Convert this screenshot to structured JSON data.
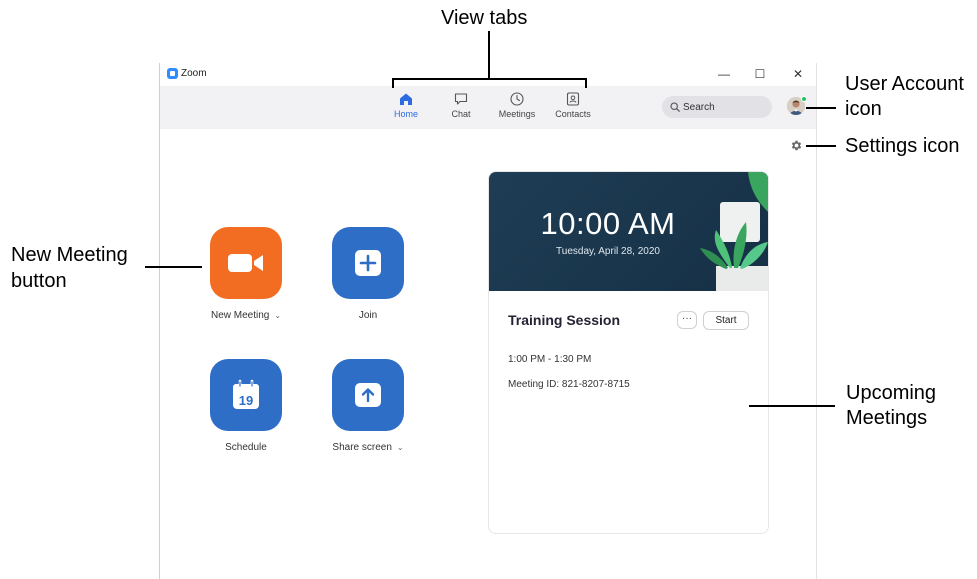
{
  "annotations": {
    "view_tabs": "View tabs",
    "user_account_line1": "User Account",
    "user_account_line2": "icon",
    "settings": "Settings icon",
    "new_meeting_line1": "New Meeting",
    "new_meeting_line2": "button",
    "upcoming_line1": "Upcoming",
    "upcoming_line2": "Meetings"
  },
  "window": {
    "title": "Zoom",
    "controls": {
      "minimize": "—",
      "maximize": "☐",
      "close": "✕"
    }
  },
  "tabs": [
    {
      "label": "Home",
      "icon": "home-icon",
      "active": true
    },
    {
      "label": "Chat",
      "icon": "chat-icon",
      "active": false
    },
    {
      "label": "Meetings",
      "icon": "clock-icon",
      "active": false
    },
    {
      "label": "Contacts",
      "icon": "contacts-icon",
      "active": false
    }
  ],
  "search": {
    "placeholder": "Search"
  },
  "actions": {
    "new_meeting": {
      "label": "New Meeting",
      "caret": "⌄",
      "color": "#f26d21"
    },
    "join": {
      "label": "Join",
      "color": "#2e6ec6"
    },
    "schedule": {
      "label": "Schedule",
      "day": "19",
      "color": "#2e6ec6"
    },
    "share_screen": {
      "label": "Share screen",
      "caret": "⌄",
      "color": "#2e6ec6"
    }
  },
  "upcoming": {
    "time": "10:00 AM",
    "date": "Tuesday, April 28, 2020",
    "meeting_title": "Training Session",
    "more_label": "···",
    "start_label": "Start",
    "time_range": "1:00 PM - 1:30 PM",
    "meeting_id": "Meeting ID: 821-8207-8715"
  },
  "colors": {
    "accent_blue": "#2d6cdf",
    "orange": "#f26d21",
    "banner": "#1c3a52",
    "presence": "#22c55e"
  }
}
